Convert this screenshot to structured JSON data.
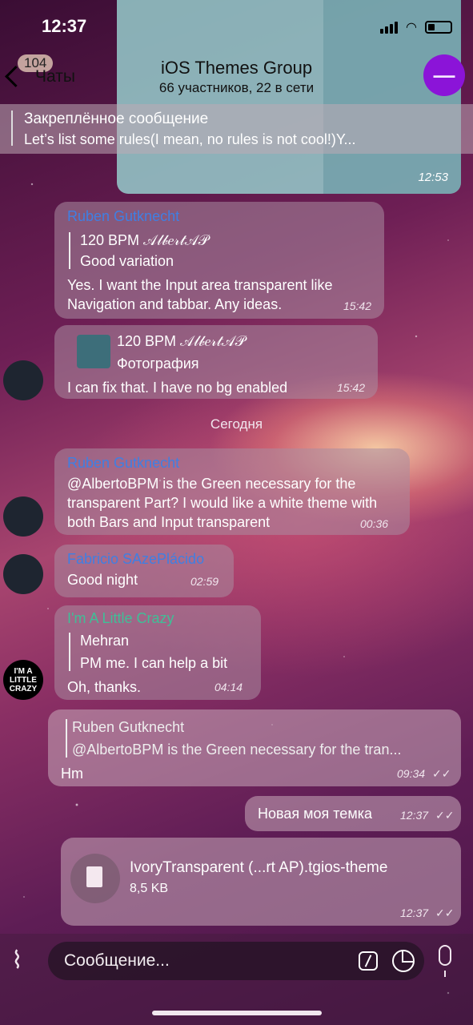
{
  "status_bar": {
    "time": "12:37"
  },
  "header": {
    "back_label": "Чаты",
    "unread_badge": "104",
    "title": "iOS Themes Group",
    "subtitle": "66 участников, 22 в сети"
  },
  "pinned": {
    "title": "Закреплённое сообщение",
    "text": "Let’s list some rules(I mean, no rules is not cool!)Y..."
  },
  "image_message": {
    "time": "12:53"
  },
  "messages": [
    {
      "sender": "Ruben Gutknecht",
      "quote_name": "120 BPM 𝒜𝓁𝒷𝑒𝓇𝓉𝒜𝒫",
      "quote_text": "Good variation",
      "text": "Yes. I want the Input area transparent like Navigation and tabbar. Any ideas.",
      "time": "15:42"
    },
    {
      "quote_name": "120 BPM 𝒜𝓁𝒷𝑒𝓇𝓉𝒜𝒫",
      "quote_text": "Фотография",
      "text": "I can fix that. I have no bg enabled",
      "time": "15:42"
    },
    {
      "sender": "Ruben Gutknecht",
      "text": "@AlbertoBPM is the Green necessary for the transparent Part? I would like a white theme with both Bars and Input transparent",
      "time": "00:36"
    },
    {
      "sender": "Fabricio SAzePlácido",
      "text": "Good night",
      "time": "02:59"
    },
    {
      "sender": "I'm A Little Crazy",
      "quote_name": "Mehran",
      "quote_text": "PM me. I can help a bit",
      "text": "Oh, thanks.",
      "time": "04:14"
    },
    {
      "quote_name": "Ruben Gutknecht",
      "quote_text": "@AlbertoBPM is the Green necessary for the tran...",
      "text": "Hm",
      "time": "09:34"
    },
    {
      "text": "Новая моя темка",
      "time": "12:37"
    },
    {
      "file_name": "IvoryTransparent (...rt AP).tgios-theme",
      "file_size": "8,5 KB",
      "time": "12:37"
    }
  ],
  "date_separator": "Сегодня",
  "avatars": {
    "crazy_text": "I'M A LITTLE CRAZY"
  },
  "input": {
    "placeholder": "Сообщение..."
  },
  "colors": {
    "sender_blue": "#3f7fe3",
    "sender_green": "#3fbf97"
  }
}
